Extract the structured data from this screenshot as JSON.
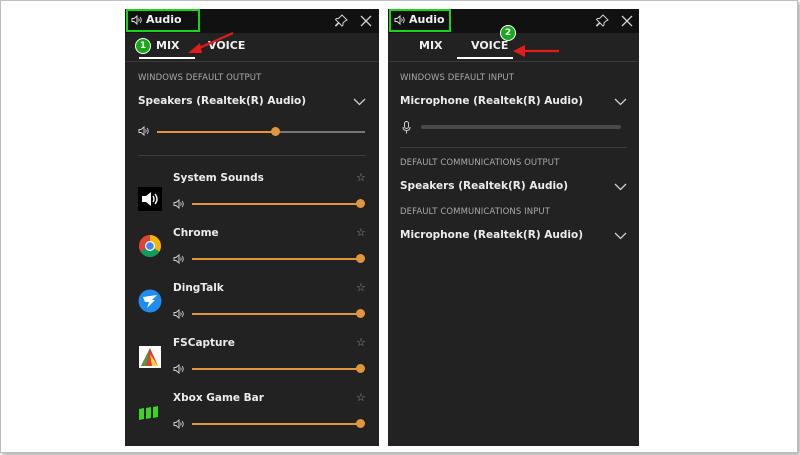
{
  "left": {
    "title": "Audio",
    "tabs": [
      {
        "label": "MIX",
        "active": true
      },
      {
        "label": "VOICE",
        "active": false
      }
    ],
    "output_section": "WINDOWS DEFAULT OUTPUT",
    "output_device": "Speakers (Realtek(R) Audio)",
    "master_volume": 0.6,
    "apps": [
      {
        "name": "System Sounds",
        "icon": "system-sounds-icon",
        "volume": 1.0
      },
      {
        "name": "Chrome",
        "icon": "chrome-icon",
        "volume": 1.0
      },
      {
        "name": "DingTalk",
        "icon": "dingtalk-icon",
        "volume": 1.0
      },
      {
        "name": "FSCapture",
        "icon": "fscapture-icon",
        "volume": 1.0
      },
      {
        "name": "Xbox Game Bar",
        "icon": "xbox-game-bar-icon",
        "volume": 1.0
      }
    ],
    "annotation": "1"
  },
  "right": {
    "title": "Audio",
    "tabs": [
      {
        "label": "MIX",
        "active": false
      },
      {
        "label": "VOICE",
        "active": true
      }
    ],
    "input_section": "WINDOWS DEFAULT INPUT",
    "input_device": "Microphone (Realtek(R) Audio)",
    "comm_output_section": "DEFAULT COMMUNICATIONS OUTPUT",
    "comm_output_device": "Speakers (Realtek(R) Audio)",
    "comm_input_section": "DEFAULT COMMUNICATIONS INPUT",
    "comm_input_device": "Microphone (Realtek(R) Audio)",
    "annotation": "2"
  },
  "colors": {
    "panel_bg": "#222222",
    "titlebar_bg": "#111111",
    "accent": "#e2963b",
    "highlight": "#19d419",
    "arrow": "#e21b1b",
    "badge": "#1aa81a"
  }
}
